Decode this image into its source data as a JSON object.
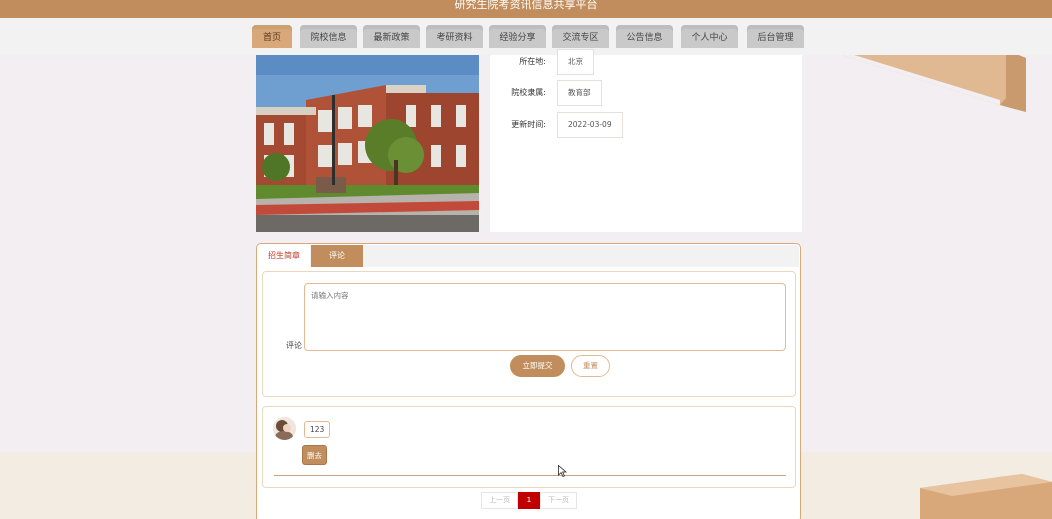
{
  "header": {
    "title": "研究生院考资讯信息共享平台"
  },
  "nav": {
    "items": [
      {
        "label": "首页",
        "active": true
      },
      {
        "label": "院校信息",
        "active": false
      },
      {
        "label": "最新政策",
        "active": false
      },
      {
        "label": "考研资料",
        "active": false
      },
      {
        "label": "经验分享",
        "active": false
      },
      {
        "label": "交流专区",
        "active": false
      },
      {
        "label": "公告信息",
        "active": false
      },
      {
        "label": "个人中心",
        "active": false
      },
      {
        "label": "后台管理",
        "active": false
      }
    ]
  },
  "school_info": {
    "location_label": "所在地:",
    "location_value": "北京",
    "affiliation_label": "院校隶属:",
    "affiliation_value": "教育部",
    "updated_label": "更新时间:",
    "updated_value": "2022-03-09"
  },
  "tabs": {
    "intro": "招生简章",
    "comments": "评论"
  },
  "comment_form": {
    "label": "评论",
    "placeholder": "请输入内容",
    "submit_label": "立即提交",
    "reset_label": "重置"
  },
  "comment_list": [
    {
      "text": "123",
      "delete_label": "删去"
    }
  ],
  "pagination": {
    "prev_label": "上一页",
    "current_page": "1",
    "next_label": "下一页"
  },
  "colors": {
    "accent": "#c18d5c",
    "nav_active": "#d9a87a",
    "pager_active": "#c00000"
  }
}
